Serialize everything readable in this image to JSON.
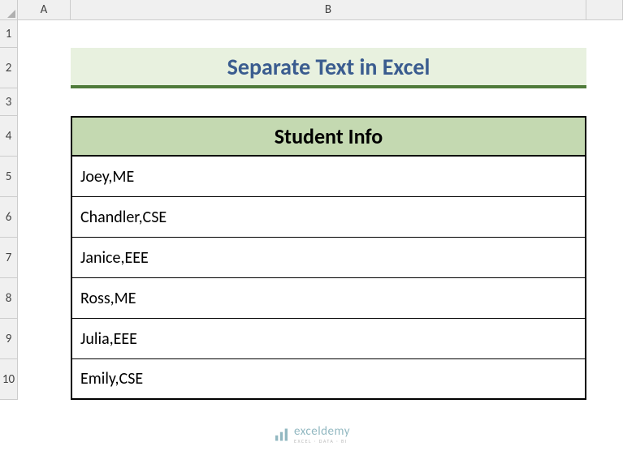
{
  "columns": {
    "A": "A",
    "B": "B"
  },
  "rows": [
    "1",
    "2",
    "3",
    "4",
    "5",
    "6",
    "7",
    "8",
    "9",
    "10"
  ],
  "title": "Separate Text in Excel",
  "table": {
    "header": "Student Info",
    "data": [
      "Joey,ME",
      "Chandler,CSE",
      "Janice,EEE",
      "Ross,ME",
      "Julia,EEE",
      "Emily,CSE"
    ]
  },
  "watermark": {
    "main": "exceldemy",
    "sub": "EXCEL · DATA · BI"
  },
  "chart_data": {
    "type": "table",
    "title": "Separate Text in Excel",
    "columns": [
      "Student Info"
    ],
    "rows": [
      [
        "Joey,ME"
      ],
      [
        "Chandler,CSE"
      ],
      [
        "Janice,EEE"
      ],
      [
        "Ross,ME"
      ],
      [
        "Julia,EEE"
      ],
      [
        "Emily,CSE"
      ]
    ]
  }
}
